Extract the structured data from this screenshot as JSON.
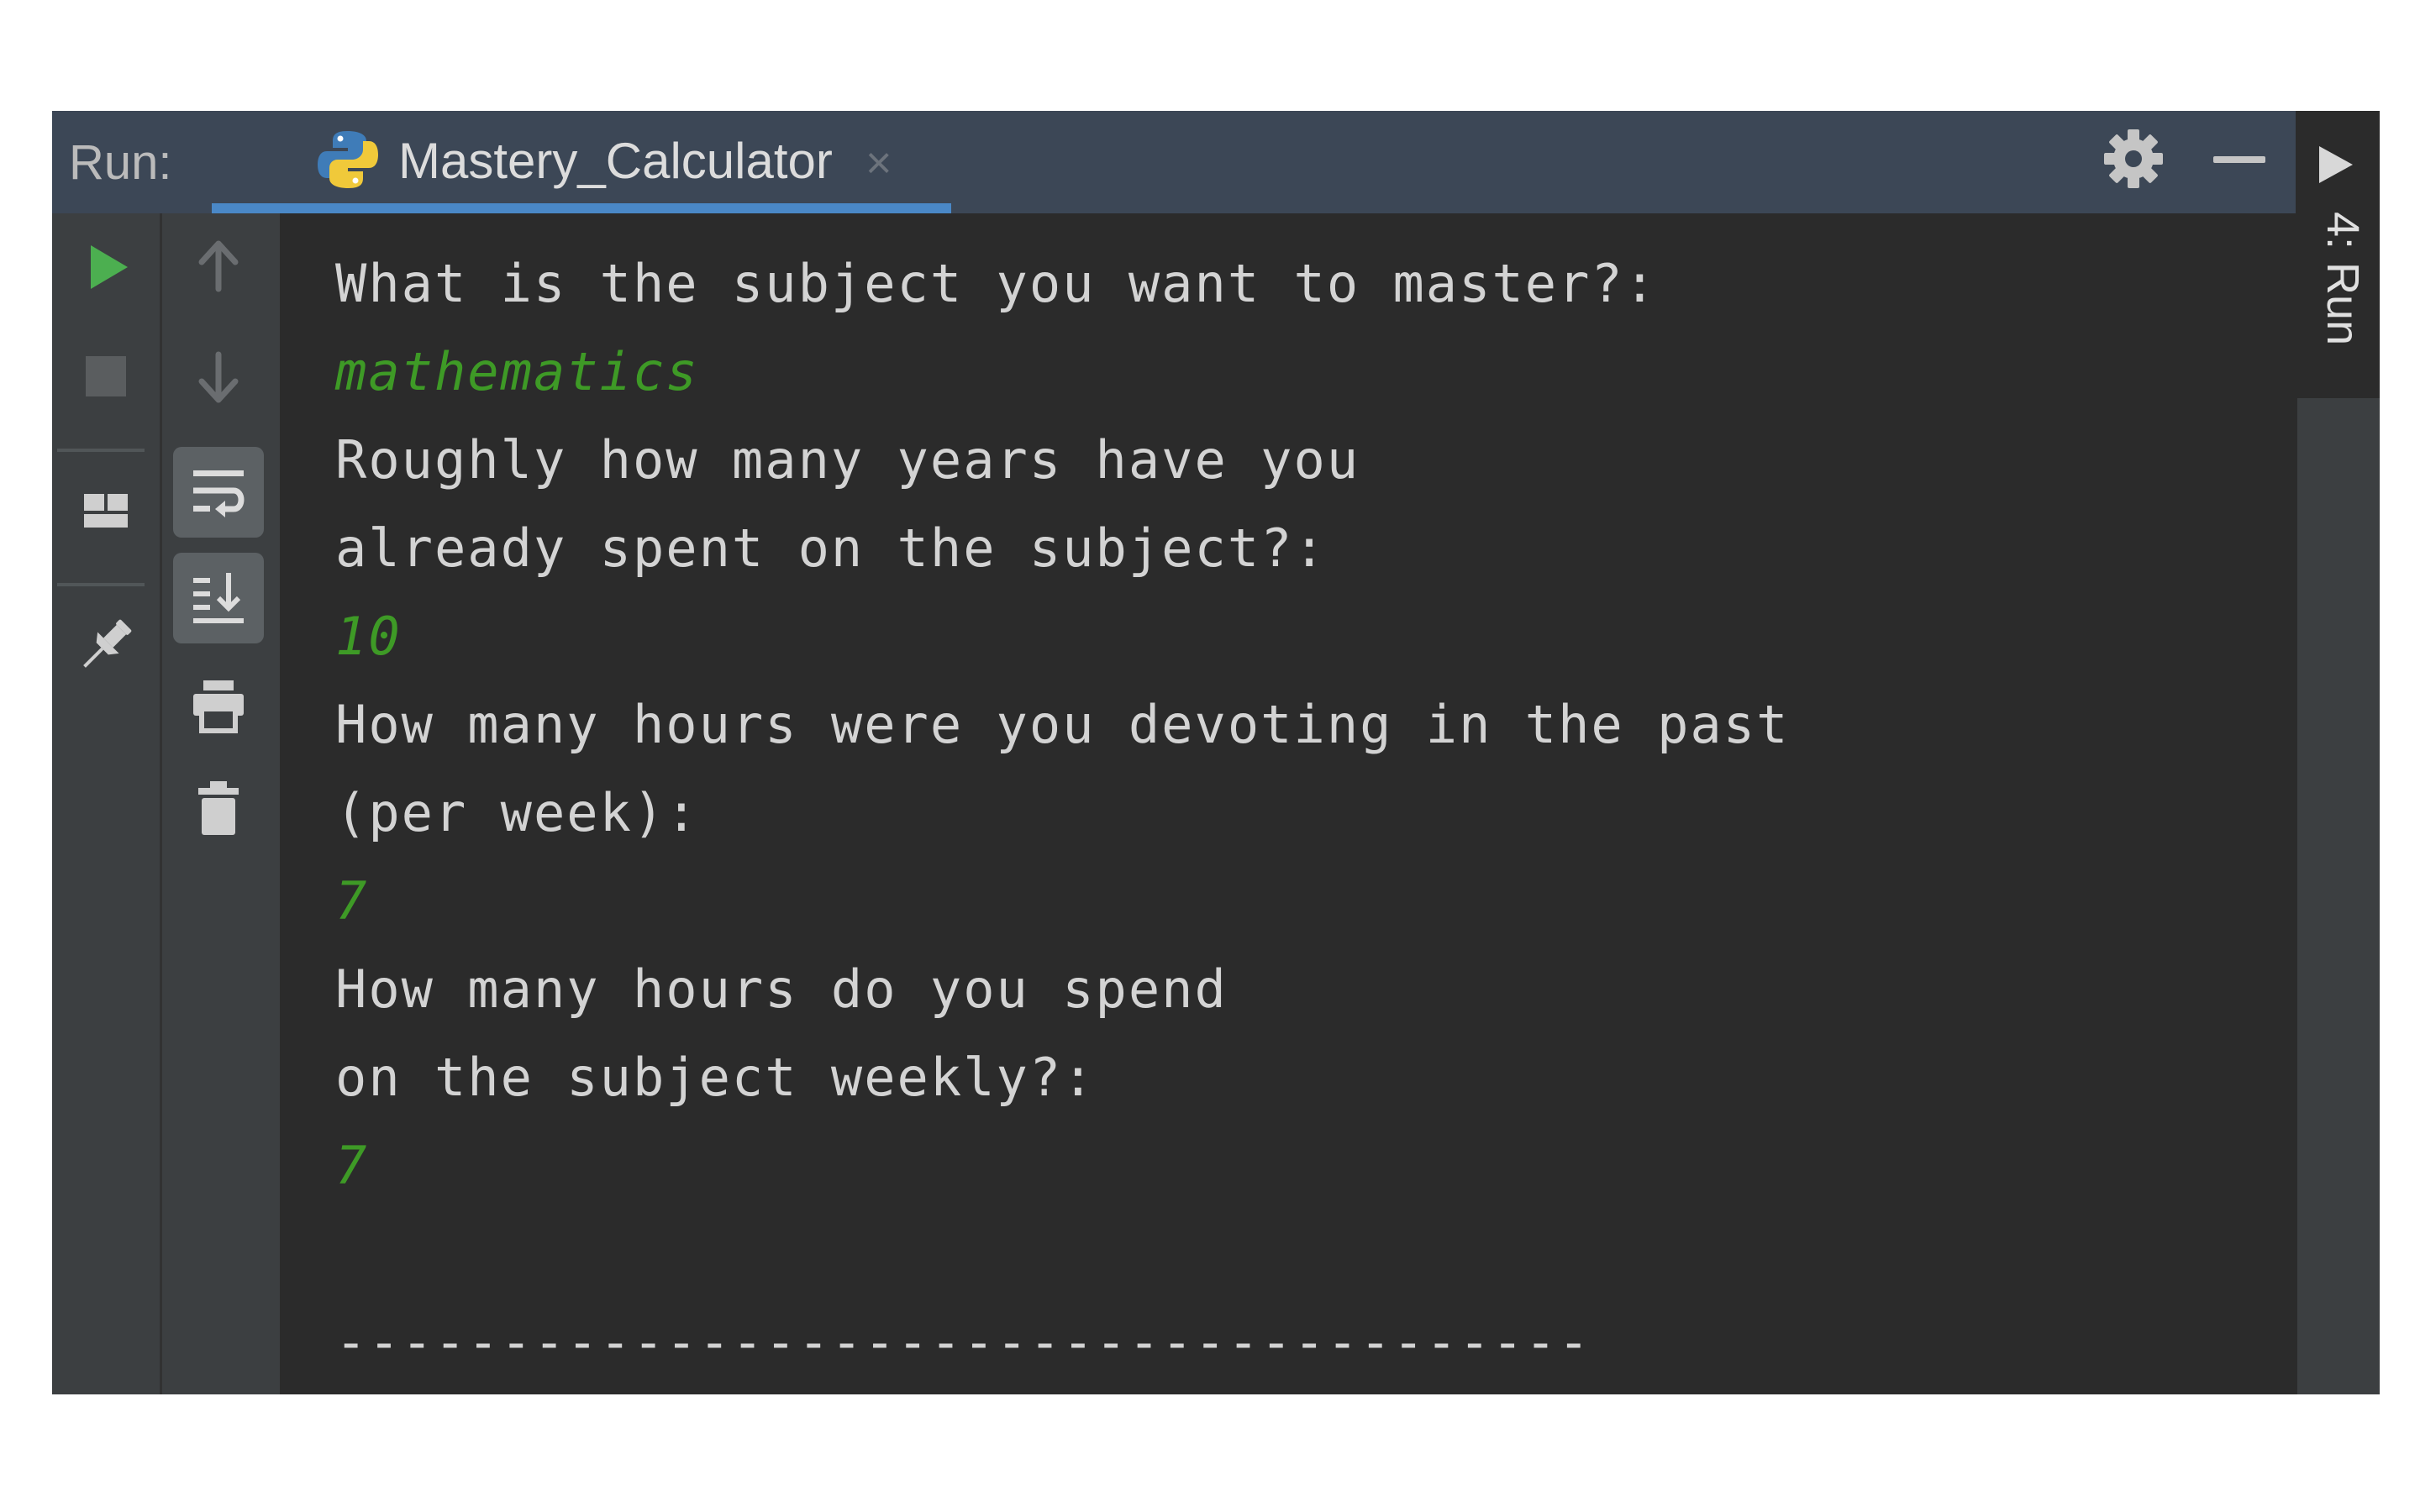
{
  "run_panel": {
    "label": "Run:",
    "tab_title": "Mastery_Calculator",
    "tab_close": "×",
    "right_stripe_label": "4: Run"
  },
  "colors": {
    "header_bg": "#3c4756",
    "console_bg": "#2b2b2b",
    "toolbar_bg": "#3c3f41",
    "tab_underline": "#4a88c7",
    "input_text": "#3e9a26",
    "output_text": "#d3d3d3",
    "run_green": "#4caf50"
  },
  "icons": {
    "toolbar_left": [
      "run-icon",
      "stop-icon",
      "layout-icon",
      "pin-icon"
    ],
    "toolbar_right": [
      "arrow-up-icon",
      "arrow-down-icon",
      "soft-wrap-icon",
      "scroll-to-end-icon",
      "print-icon",
      "trash-icon"
    ],
    "header": [
      "python-icon",
      "gear-icon",
      "minimize-icon"
    ]
  },
  "console": {
    "lines": [
      {
        "text": "What is the subject you want to master?:",
        "type": "output"
      },
      {
        "text": "mathematics",
        "type": "input"
      },
      {
        "text": "Roughly how many years have you",
        "type": "output"
      },
      {
        "text": "already spent on the subject?:",
        "type": "output"
      },
      {
        "text": "10",
        "type": "input"
      },
      {
        "text": "How many hours were you devoting in the past",
        "type": "output"
      },
      {
        "text": "(per week):",
        "type": "output"
      },
      {
        "text": "7",
        "type": "input"
      },
      {
        "text": "How many hours do you spend",
        "type": "output"
      },
      {
        "text": "on the subject weekly?:",
        "type": "output"
      },
      {
        "text": "7",
        "type": "input"
      },
      {
        "text": "",
        "type": "output"
      },
      {
        "text": "--------------------------------------",
        "type": "output"
      }
    ]
  }
}
